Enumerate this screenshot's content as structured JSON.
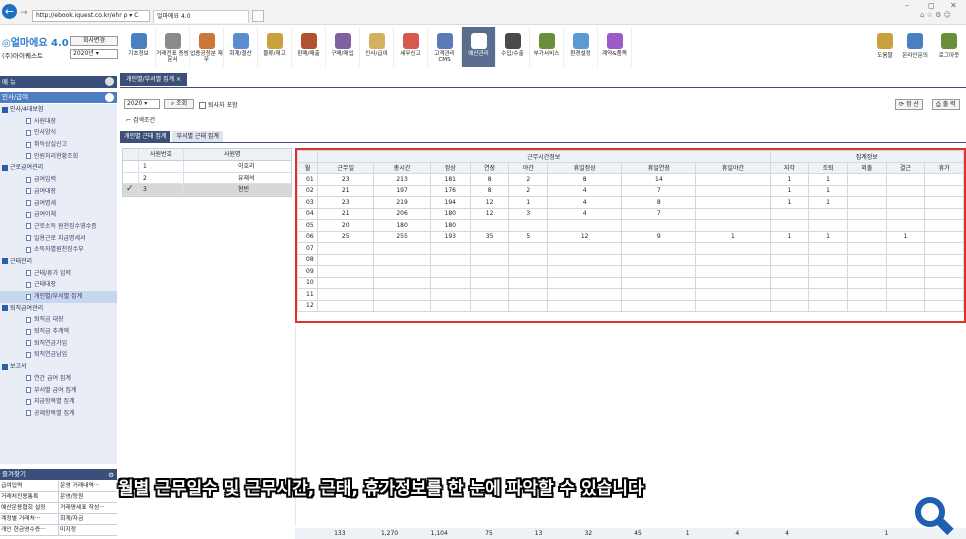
{
  "browser": {
    "address": "http://ebook.iquest.co.kr/ehr",
    "tab_title": "얼마에요 4.0",
    "addr_controls": "ρ ▾ C"
  },
  "app": {
    "logo_main": "얼마에요",
    "logo_ver": "4.0",
    "company": "(주)아이퀘스트",
    "change_company": "회사변경",
    "year": "2020년"
  },
  "toolbar": [
    "기초정보",
    "거래전표 증빙문서",
    "업종공정분 재무",
    "회계/결산",
    "물류/재고",
    "판매/매출",
    "구매/매입",
    "인사/급여",
    "세무신고",
    "고객관리 CMS",
    "예산관리",
    "수입/수출",
    "부가서비스",
    "환경설정",
    "계약&품목"
  ],
  "toolbar_colors": [
    "#4a7fc1",
    "#8a8a8a",
    "#c9773a",
    "#5b8ed1",
    "#c9a13a",
    "#b0522e",
    "#8060a0",
    "#d4b061",
    "#d6584f",
    "#5a7bb8",
    "#ffffff",
    "#4a4a4a",
    "#6b8e3a",
    "#5b9bd5",
    "#9a5ac9"
  ],
  "right_tools": [
    "도움말",
    "온라인문의",
    "로그아웃"
  ],
  "menu": {
    "title": "메 뉴",
    "section": "인사/급여"
  },
  "tree": [
    {
      "t": "f",
      "label": "인사/4대보험"
    },
    {
      "t": "l",
      "label": "사원대장"
    },
    {
      "t": "l",
      "label": "인사양식"
    },
    {
      "t": "l",
      "label": "취득상실신고"
    },
    {
      "t": "l",
      "label": "인원처리현황조회"
    },
    {
      "t": "f",
      "label": "근로급여관리"
    },
    {
      "t": "l",
      "label": "급여입력"
    },
    {
      "t": "l",
      "label": "급여대장"
    },
    {
      "t": "l",
      "label": "급여명세"
    },
    {
      "t": "l",
      "label": "급여이체"
    },
    {
      "t": "l",
      "label": "근로소득 원천징수영수증"
    },
    {
      "t": "l",
      "label": "일용근로 지급명세서"
    },
    {
      "t": "l",
      "label": "소득자별원천징수부"
    },
    {
      "t": "f",
      "label": "근태관리"
    },
    {
      "t": "l",
      "label": "근태/휴가 입력"
    },
    {
      "t": "l",
      "label": "근태대장"
    },
    {
      "t": "l",
      "label": "개인별/부서별 집계",
      "sel": true
    },
    {
      "t": "f",
      "label": "퇴직급여관리"
    },
    {
      "t": "l",
      "label": "퇴직금 대장"
    },
    {
      "t": "l",
      "label": "퇴직금 추계액"
    },
    {
      "t": "l",
      "label": "퇴직연금가입"
    },
    {
      "t": "l",
      "label": "퇴직연금납입"
    },
    {
      "t": "f",
      "label": "보고서"
    },
    {
      "t": "l",
      "label": "연간 급여 집계"
    },
    {
      "t": "l",
      "label": "부서별 급여 집계"
    },
    {
      "t": "l",
      "label": "지급항목별 집계"
    },
    {
      "t": "l",
      "label": "공제항목별 집계"
    }
  ],
  "favorites": {
    "title": "즐겨찾기",
    "rows": [
      [
        "급여입력",
        "운영 거래내역···"
      ],
      [
        "거래처전용통록",
        "운영/등원"
      ],
      [
        "예산운용협회 설정",
        "거래명세표 작성···"
      ],
      [
        "계정별 거래처···",
        "회계/자금"
      ],
      [
        "개인 현금영수증···",
        "미지정"
      ]
    ]
  },
  "page_tabs": [
    "개인별/부서별 집계",
    "×"
  ],
  "filter": {
    "year": "2020",
    "search": "조회",
    "retired": "퇴사자 포함",
    "cond": "검색조건",
    "close": "정 산",
    "print": "출 력"
  },
  "sub_tabs": [
    "개인별 근태 집계",
    "부서별 근태 집계"
  ],
  "employees": {
    "headers": [
      "사원번호",
      "사원명"
    ],
    "rows": [
      [
        "1",
        "이호리"
      ],
      [
        "2",
        "유재석"
      ],
      [
        "3",
        "현빈"
      ]
    ]
  },
  "grid": {
    "group1": "근무시간정보",
    "group2": "집계정보",
    "headers": [
      "월",
      "근무일",
      "총시간",
      "정상",
      "연장",
      "야간",
      "휴일정상",
      "휴일연장",
      "휴일야간",
      "지각",
      "조퇴",
      "외출",
      "결근",
      "휴가"
    ],
    "rows": [
      [
        "01",
        "23",
        "213",
        "181",
        "8",
        "2",
        "8",
        "14",
        "",
        "1",
        "1",
        "",
        "",
        ""
      ],
      [
        "02",
        "21",
        "197",
        "176",
        "8",
        "2",
        "4",
        "7",
        "",
        "1",
        "1",
        "",
        "",
        ""
      ],
      [
        "03",
        "23",
        "219",
        "194",
        "12",
        "1",
        "4",
        "8",
        "",
        "1",
        "1",
        "",
        "",
        ""
      ],
      [
        "04",
        "21",
        "206",
        "180",
        "12",
        "3",
        "4",
        "7",
        "",
        "",
        "",
        "",
        "",
        ""
      ],
      [
        "05",
        "20",
        "180",
        "180",
        "",
        "",
        "",
        "",
        "",
        "",
        "",
        "",
        "",
        ""
      ],
      [
        "06",
        "25",
        "255",
        "193",
        "35",
        "5",
        "12",
        "9",
        "1",
        "1",
        "1",
        "",
        "1",
        ""
      ],
      [
        "07",
        "",
        "",
        "",
        "",
        "",
        "",
        "",
        "",
        "",
        "",
        "",
        "",
        ""
      ],
      [
        "08",
        "",
        "",
        "",
        "",
        "",
        "",
        "",
        "",
        "",
        "",
        "",
        "",
        ""
      ],
      [
        "09",
        "",
        "",
        "",
        "",
        "",
        "",
        "",
        "",
        "",
        "",
        "",
        "",
        ""
      ],
      [
        "10",
        "",
        "",
        "",
        "",
        "",
        "",
        "",
        "",
        "",
        "",
        "",
        "",
        ""
      ],
      [
        "11",
        "",
        "",
        "",
        "",
        "",
        "",
        "",
        "",
        "",
        "",
        "",
        "",
        ""
      ],
      [
        "12",
        "",
        "",
        "",
        "",
        "",
        "",
        "",
        "",
        "",
        "",
        "",
        "",
        ""
      ]
    ],
    "totals": [
      "",
      "133",
      "1,270",
      "1,104",
      "75",
      "13",
      "32",
      "45",
      "1",
      "4",
      "4",
      "",
      "1",
      ""
    ]
  },
  "caption": "월별 근무일수 및 근무시간, 근태, 휴가정보를 한 눈에 파악할 수 있습니다"
}
